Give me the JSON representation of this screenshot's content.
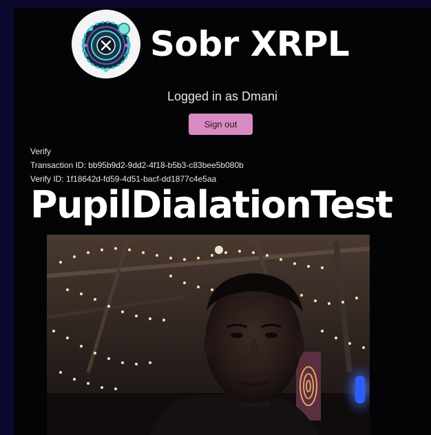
{
  "brand": {
    "name": "Sobr XRPL",
    "logo_icon": "x-coin-emblem-icon"
  },
  "session": {
    "logged_in_text": "Logged in as Dmani",
    "sign_out_label": "Sign out"
  },
  "verify": {
    "heading": "Verify",
    "transaction_id": "Transaction ID: bb95b9d2-9dd2-4f18-b5b3-c83bee5b080b",
    "verify_id": "Verify ID: 1f18642d-fd59-4d51-bacf-dd1877c4e5aa"
  },
  "test": {
    "title": "PupilDialationTest"
  },
  "colors": {
    "page_background": "#0b0a2e",
    "panel_background": "#040406",
    "sign_out_button": "#d88bc2",
    "logo_accent": "#3bbfd0"
  }
}
